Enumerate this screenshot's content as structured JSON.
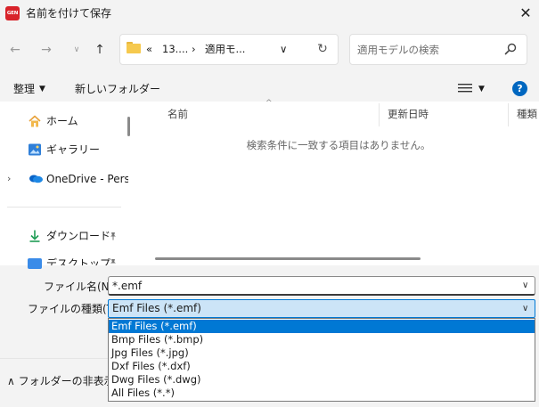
{
  "window": {
    "app_logo": "GEN",
    "title": "名前を付けて保存",
    "close_glyph": "✕"
  },
  "nav": {
    "back_glyph": "←",
    "forward_glyph": "→",
    "history_glyph": "∨",
    "up_glyph": "↑",
    "breadcrumb_overflow": "«",
    "breadcrumb_items": [
      "13....",
      "適用モ..."
    ],
    "breadcrumb_separator": "›",
    "refresh_glyph": "↻",
    "search_placeholder": "適用モデルの検索"
  },
  "toolbar": {
    "organize_label": "整理",
    "caret_glyph": "▼",
    "new_folder_label": "新しいフォルダー",
    "help_glyph": "?"
  },
  "sidebar": {
    "items": [
      {
        "label": "ホーム",
        "icon": "home-icon"
      },
      {
        "label": "ギャラリー",
        "icon": "gallery-icon"
      },
      {
        "label": "OneDrive - Perso",
        "icon": "onedrive-icon"
      },
      {
        "label": "ダウンロード",
        "icon": "download-icon"
      },
      {
        "label": "デスクトップ",
        "icon": "desktop-icon"
      }
    ],
    "expand_glyph": "›",
    "pin_glyph": "📌"
  },
  "file_list": {
    "columns": [
      "名前",
      "更新日時",
      "種類"
    ],
    "sort_glyph": "^",
    "empty_message": "検索条件に一致する項目はありません。"
  },
  "form": {
    "filename_label": "ファイル名(N):",
    "filename_value": "*.emf",
    "filetype_label": "ファイルの種類(T):",
    "filetype_value": "Emf Files (*.emf)",
    "chevron_glyph": "∨",
    "filetype_options": [
      "Emf Files (*.emf)",
      "Bmp Files (*.bmp)",
      "Jpg Files (*.jpg)",
      "Dxf Files (*.dxf)",
      "Dwg Files (*.dwg)",
      "All Files (*.*)"
    ],
    "selected_option_index": 0
  },
  "footer": {
    "hide_folders_glyph": "∧",
    "hide_folders_label": "フォルダーの非表示"
  },
  "colors": {
    "accent": "#0078d4",
    "selection_bg": "#cce4f7",
    "app_logo": "#d8232a",
    "folder": "#f6c94e"
  }
}
